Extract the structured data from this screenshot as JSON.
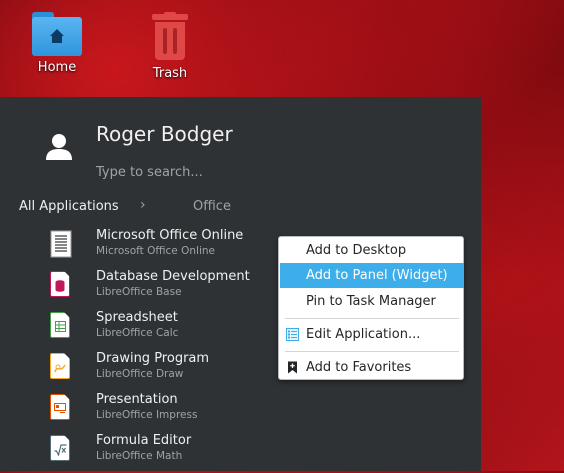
{
  "desktop": {
    "icons": [
      {
        "label": "Home",
        "icon": "folder-home-icon"
      },
      {
        "label": "Trash",
        "icon": "trash-icon"
      }
    ]
  },
  "launcher": {
    "user_name": "Roger Bodger",
    "search_placeholder": "Type to search...",
    "breadcrumb": {
      "root": "All Applications",
      "separator": "›",
      "current": "Office"
    },
    "apps": [
      {
        "name": "Microsoft Office Online",
        "sub": "Microsoft Office Online",
        "icon": "text-document-icon"
      },
      {
        "name": "Database Development",
        "sub": "LibreOffice Base",
        "icon": "libreoffice-base-icon",
        "color": "#c2185b"
      },
      {
        "name": "Spreadsheet",
        "sub": "LibreOffice Calc",
        "icon": "libreoffice-calc-icon",
        "color": "#43a047"
      },
      {
        "name": "Drawing Program",
        "sub": "LibreOffice Draw",
        "icon": "libreoffice-draw-icon",
        "color": "#f9a825"
      },
      {
        "name": "Presentation",
        "sub": "LibreOffice Impress",
        "icon": "libreoffice-impress-icon",
        "color": "#e65100"
      },
      {
        "name": "Formula Editor",
        "sub": "LibreOffice Math",
        "icon": "libreoffice-math-icon",
        "color": "#546e7a"
      }
    ]
  },
  "context_menu": {
    "items": [
      {
        "label": "Add to Desktop"
      },
      {
        "label": "Add to Panel (Widget)",
        "highlighted": true
      },
      {
        "label": "Pin to Task Manager"
      },
      {
        "label": "Edit Application...",
        "icon": "edit-list-icon"
      },
      {
        "label": "Add to Favorites",
        "icon": "bookmark-add-icon"
      }
    ]
  },
  "colors": {
    "accent": "#3daee9",
    "panel": "#2f3235",
    "menu_bg": "#ffffff"
  }
}
